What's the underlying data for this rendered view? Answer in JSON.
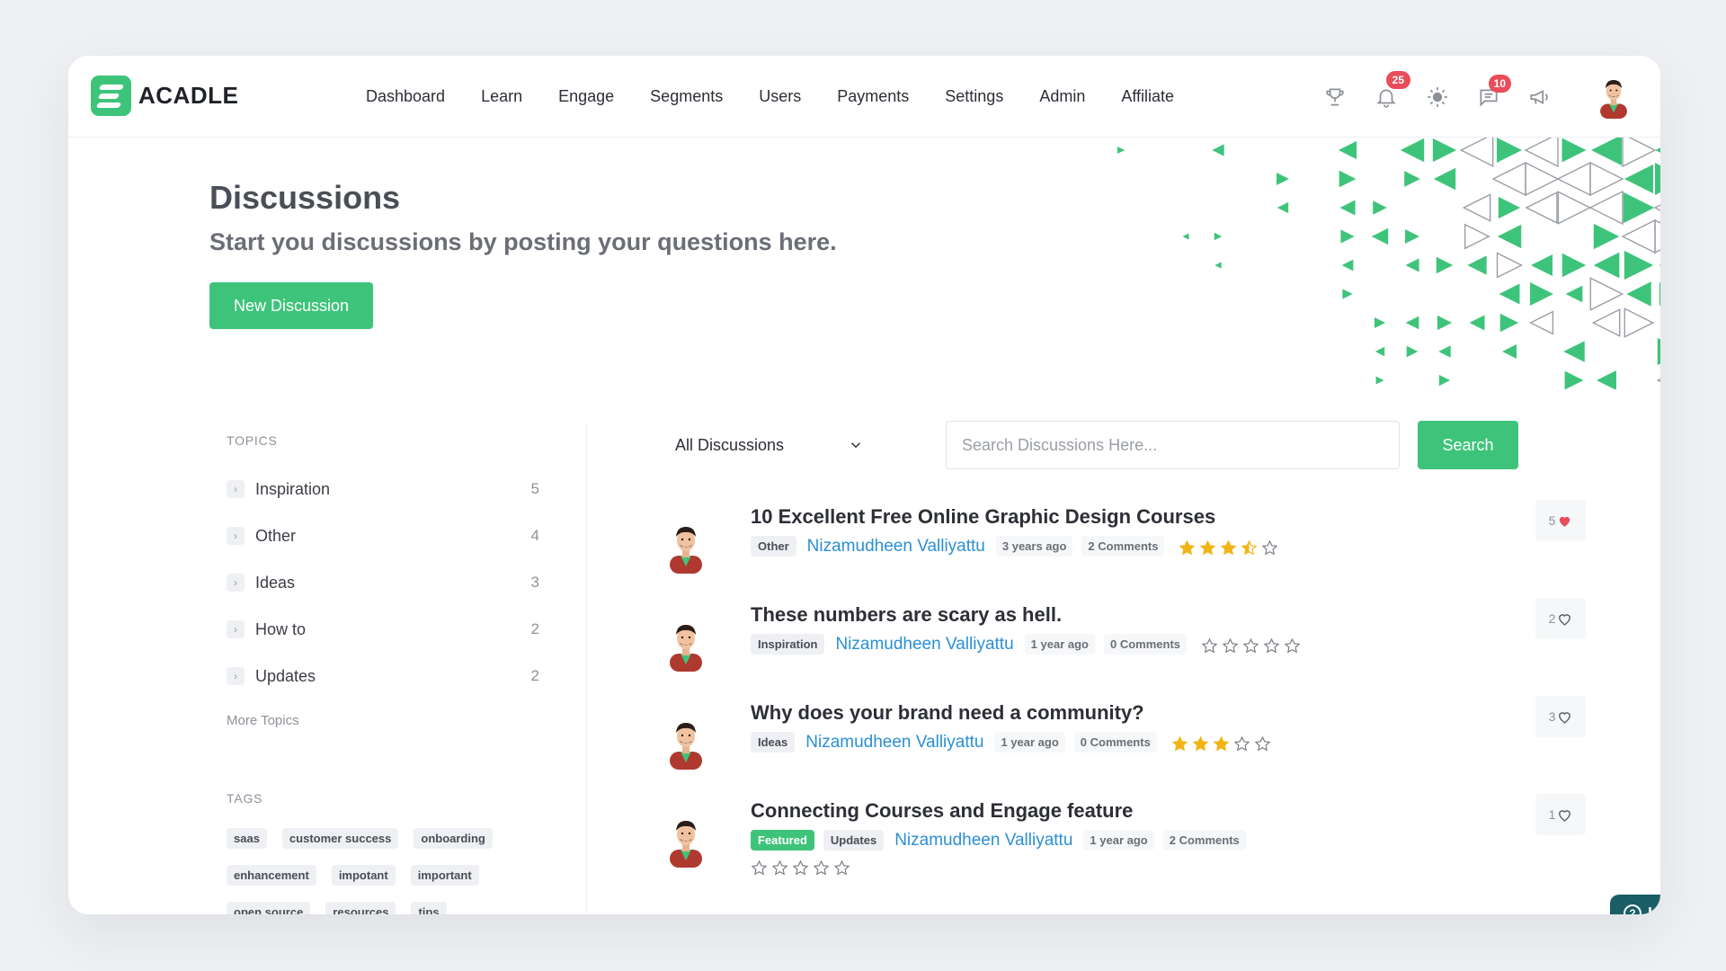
{
  "app": {
    "brand": "ACADLE",
    "brand_color": "#3ec47a"
  },
  "nav": [
    "Dashboard",
    "Learn",
    "Engage",
    "Segments",
    "Users",
    "Payments",
    "Settings",
    "Admin",
    "Affiliate"
  ],
  "header_icons": {
    "notifications_badge": "25",
    "messages_badge": "10",
    "icons": [
      "trophy-icon",
      "bell-icon",
      "sun-icon",
      "chat-icon",
      "megaphone-icon"
    ]
  },
  "hero": {
    "title": "Discussions",
    "subtitle": "Start you discussions by posting your questions here.",
    "new_button": "New Discussion"
  },
  "sidebar": {
    "topics_heading": "TOPICS",
    "topics": [
      {
        "label": "Inspiration",
        "count": "5"
      },
      {
        "label": "Other",
        "count": "4"
      },
      {
        "label": "Ideas",
        "count": "3"
      },
      {
        "label": "How to",
        "count": "2"
      },
      {
        "label": "Updates",
        "count": "2"
      }
    ],
    "more_topics": "More Topics",
    "tags_heading": "TAGS",
    "tags": [
      "saas",
      "customer success",
      "onboarding",
      "enhancement",
      "impotant",
      "important",
      "open source",
      "resources",
      "tips"
    ]
  },
  "filter": {
    "selected": "All Discussions"
  },
  "search": {
    "placeholder": "Search Discussions Here...",
    "button": "Search"
  },
  "posts": [
    {
      "title": "10 Excellent Free Online Graphic Design Courses",
      "categories": [
        "Other"
      ],
      "author": "Nizamudheen Valliyattu",
      "time": "3 years ago",
      "comments": "2 Comments",
      "rating": 3.5,
      "likes": "5",
      "liked": true
    },
    {
      "title": "These numbers are scary as hell.",
      "categories": [
        "Inspiration"
      ],
      "author": "Nizamudheen Valliyattu",
      "time": "1 year ago",
      "comments": "0 Comments",
      "rating": 0,
      "likes": "2",
      "liked": false
    },
    {
      "title": "Why does your brand need a community?",
      "categories": [
        "Ideas"
      ],
      "author": "Nizamudheen Valliyattu",
      "time": "1 year ago",
      "comments": "0 Comments",
      "rating": 3,
      "likes": "3",
      "liked": false
    },
    {
      "title": "Connecting Courses and Engage feature",
      "categories": [
        "Featured",
        "Updates"
      ],
      "author": "Nizamudheen Valliyattu",
      "time": "1 year ago",
      "comments": "2 Comments",
      "rating": 0,
      "likes": "1",
      "liked": false
    }
  ],
  "help": {
    "label": "Help"
  },
  "colors": {
    "star": "#f2b415",
    "heart": "#e94c5a",
    "link": "#2a8fd4",
    "help_bg": "#1a5e66"
  }
}
